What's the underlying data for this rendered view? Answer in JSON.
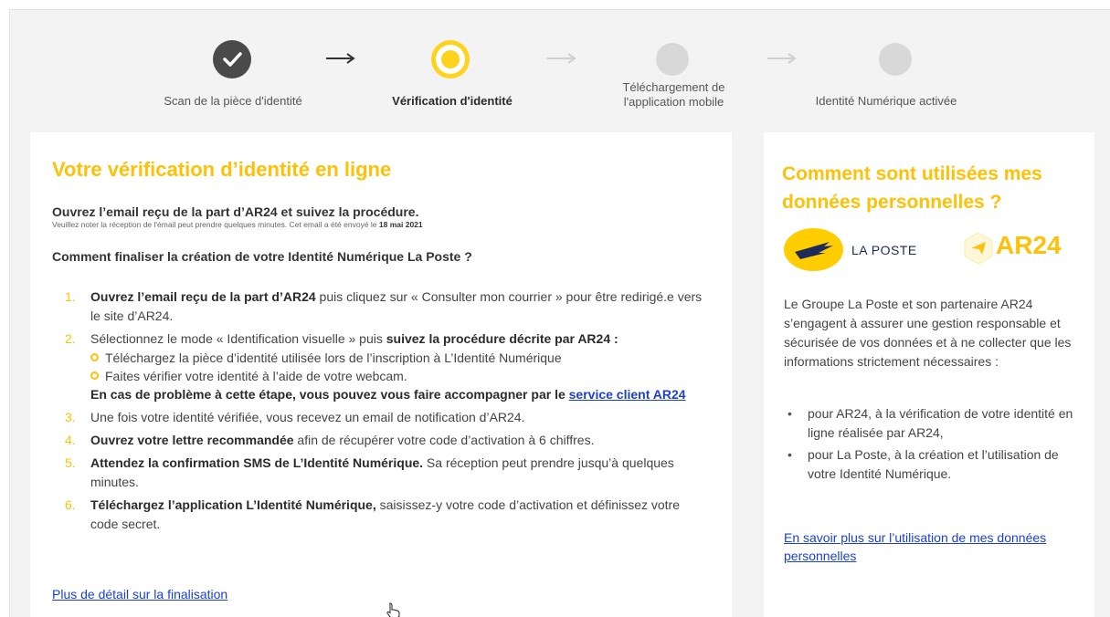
{
  "stepper": {
    "steps": [
      {
        "label": "Scan de la pièce d'identité",
        "state": "done"
      },
      {
        "label": "Vérification d'identité",
        "state": "active"
      },
      {
        "label": "Téléchargement de l'application mobile",
        "label_line1": "Téléchargement de",
        "label_line2": "l'application mobile",
        "state": "todo"
      },
      {
        "label": "Identité Numérique activée",
        "state": "todo"
      }
    ]
  },
  "main": {
    "title": "Votre vérification d’identité en ligne",
    "intro_title": "Ouvrez l’email reçu de la part d’AR24 et suivez la procédure.",
    "intro_note": "Veuillez noter la réception de l'émail peut prendre quelques minutes. Cet email a été envoyé le",
    "intro_date": "18 mai 2021",
    "question": "Comment finaliser la création de votre Identité Numérique La Poste ?",
    "steps": [
      {
        "num": "1.",
        "bold": "Ouvrez l’email reçu de la part d’AR24",
        "text": " puis cliquez sur « Consulter mon courrier » pour être redirigé.e vers le site d’AR24."
      },
      {
        "num": "2.",
        "text": "Sélectionnez le mode « Identification visuelle » puis ",
        "bold": "suivez la procédure décrite par AR24 :",
        "sub": [
          "Téléchargez la pièce d’identité utilisée lors de l’inscription à L’Identité Numérique",
          "Faites vérifier votre identité à l’aide de votre webcam."
        ],
        "problem": "En cas de problème à cette étape, vous pouvez vous faire accompagner par le ",
        "problem_link": "service client AR24"
      },
      {
        "num": "3.",
        "text": "Une fois votre identité vérifiée, vous recevez un email de notification d’AR24."
      },
      {
        "num": "4.",
        "bold": "Ouvrez votre lettre recommandée",
        "text": " afin de récupérer votre code d’activation à 6 chiffres."
      },
      {
        "num": "5.",
        "bold": "Attendez la confirmation SMS de L’Identité Numérique.",
        "text": " Sa réception peut prendre jusqu’à quelques minutes."
      },
      {
        "num": "6.",
        "bold": "Téléchargez l’application L’Identité Numérique,",
        "text": " saisissez-y votre code d’activation et définissez votre code secret."
      }
    ],
    "detail_link": "Plus de détail sur la finalisation"
  },
  "side": {
    "title": "Comment sont utilisées mes données personnelles ?",
    "logo_laposte": "LA POSTE",
    "logo_ar24": "AR24",
    "text": "Le Groupe La Poste et son partenaire AR24 s’engagent à assurer une gestion responsable et sécurisée de vos données et à ne collecter que les informations strictement nécessaires :",
    "bullets": [
      "pour AR24, à la vérification de votre identité en ligne réalisée par AR24,",
      "pour La Poste, à la création et l’utilisation de votre Identité Numérique."
    ],
    "link": "En savoir plus sur l’utilisation de mes données personnelles"
  },
  "colors": {
    "accent": "#ffc107",
    "link": "#1a3fd6",
    "done": "#4a4a4a",
    "todo": "#d8d8d8"
  }
}
